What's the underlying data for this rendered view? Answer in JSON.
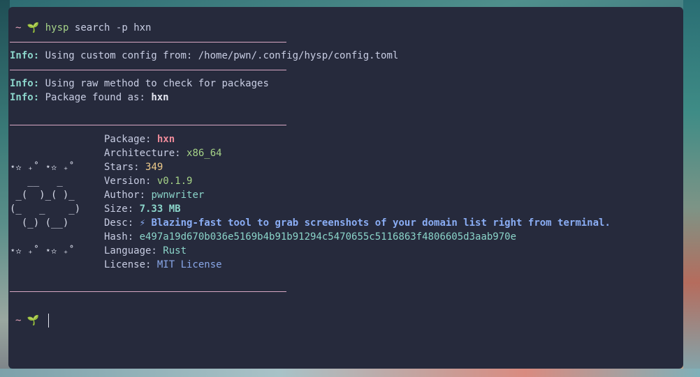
{
  "prompt": {
    "tilde": "~",
    "sprout": "🌱",
    "command": "hysp",
    "args": "search -p hxn"
  },
  "messages": [
    {
      "label": "Info:",
      "text": " Using custom config from: /home/pwn/.config/hysp/config.toml"
    },
    {
      "label": "Info:",
      "text": " Using raw method to check for packages"
    },
    {
      "label": "Info:",
      "text": " Package found as: ",
      "bold": "hxn"
    }
  ],
  "ascii_art": [
    "⋆✫ ₊˚ ⋆✫ ₊˚",
    "   __   _",
    " _(  )_( )_",
    "(_   _    _)",
    "  (_) (__)",
    "⋆✫ ₊˚ ⋆✫ ₊˚"
  ],
  "details": {
    "package": {
      "key": "Package: ",
      "value": "hxn"
    },
    "architecture": {
      "key": "Architecture: ",
      "value": "x86_64"
    },
    "stars": {
      "key": "Stars: ",
      "value": "349"
    },
    "version": {
      "key": "Version: ",
      "value": "v0.1.9"
    },
    "author": {
      "key": "Author: ",
      "value": "pwnwriter"
    },
    "size": {
      "key": "Size: ",
      "value": "7.33 MB"
    },
    "desc": {
      "key": "Desc: ",
      "icon": "lightning-bolt-icon",
      "value": "Blazing-fast tool to grab screenshots of your domain list right from terminal."
    },
    "hash": {
      "key": "Hash: ",
      "value": "e497a19d670b036e5169b4b91b91294c5470655c5116863f4806605d3aab970e"
    },
    "language": {
      "key": "Language: ",
      "value": "Rust"
    },
    "license": {
      "key": "License: ",
      "value": "MIT License"
    }
  },
  "colors": {
    "terminal_bg": "#262a3c",
    "rule": "#d9a8c4",
    "info": "#8bd5ca",
    "package": "#ee8b9a",
    "accent_blue": "#8aadf4"
  }
}
